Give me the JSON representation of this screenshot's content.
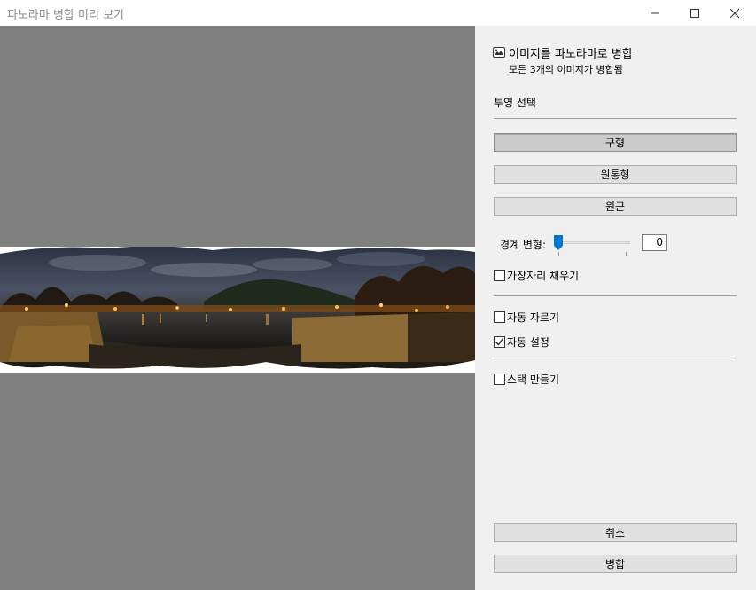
{
  "window": {
    "title": "파노라마 병합 미리 보기",
    "minimize_glyph": "—",
    "maximize_glyph": "☐",
    "close_glyph": "✕"
  },
  "panel": {
    "merge_title": "이미지를 파노라마로 병합",
    "merge_subtitle": "모든 3개의 이미지가 병합됨",
    "projection_label": "투영 선택",
    "projection_options": [
      "구형",
      "원통형",
      "원근"
    ],
    "selected_projection": "구형",
    "boundary_warp_label": "경계 변형:",
    "boundary_warp_value": "0",
    "fill_edges_label": "가장자리 채우기",
    "fill_edges_checked": false,
    "auto_crop_label": "자동 자르기",
    "auto_crop_checked": false,
    "auto_settings_label": "자동 설정",
    "auto_settings_checked": true,
    "create_stack_label": "스택 만들기",
    "create_stack_checked": false,
    "cancel_label": "취소",
    "merge_label": "병합"
  },
  "icons": {
    "merge": "panorama-icon",
    "slider": "slider-thumb-icon",
    "checkmark": "checkmark-icon"
  },
  "colors": {
    "preview_bg": "#808080",
    "panel_bg": "#f0f0f0",
    "slider_accent": "#0078d7"
  }
}
